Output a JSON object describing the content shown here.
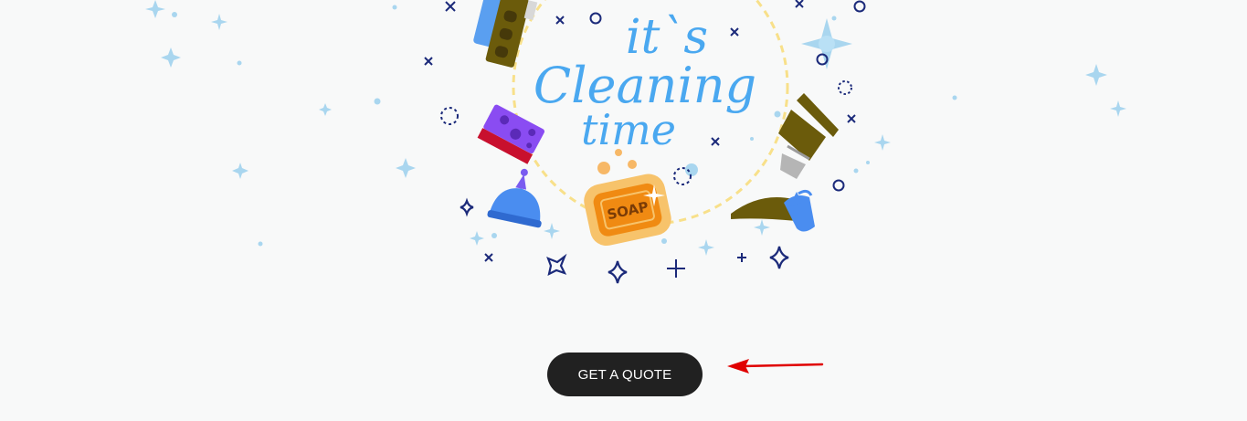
{
  "hero": {
    "headline_line1": "it`s",
    "headline_line2": "Cleaning",
    "headline_line3": "time",
    "soap_label": "SOAP"
  },
  "cta": {
    "label": "GET A QUOTE"
  },
  "colors": {
    "background": "#f8f9f9",
    "headline": "#4aa8f0",
    "button": "#212121",
    "button_text": "#ffffff",
    "arrow": "#e00000",
    "soap": "#f08a12",
    "sponge": "#8a4cf2",
    "dashed_circle": "#f8e08a"
  },
  "icons": [
    "sparkle-icon",
    "sponge-icon",
    "soap-icon",
    "spray-bottle-icon",
    "brush-icon",
    "scrub-brush-icon",
    "plunger-icon",
    "arrow-icon"
  ]
}
